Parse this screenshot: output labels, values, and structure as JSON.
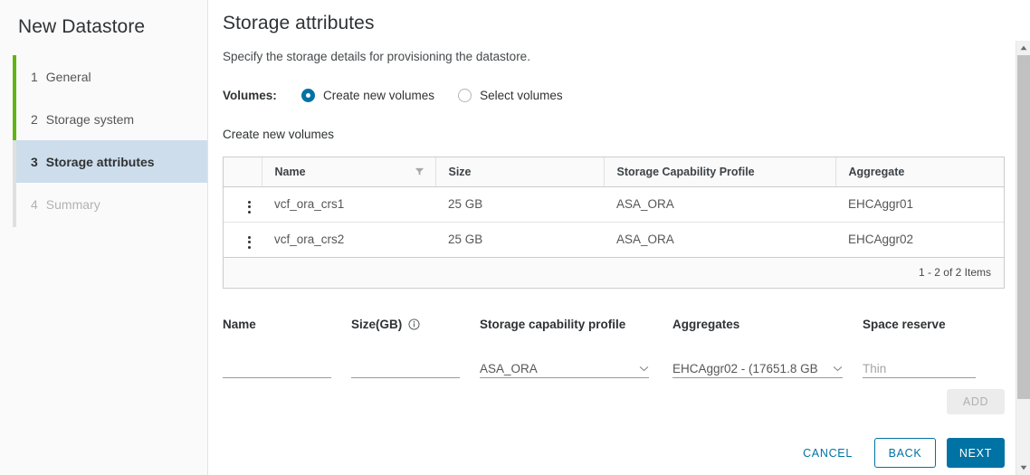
{
  "sidebar": {
    "title": "New Datastore",
    "steps": [
      {
        "num": "1",
        "label": "General",
        "state": "done"
      },
      {
        "num": "2",
        "label": "Storage system",
        "state": "done"
      },
      {
        "num": "3",
        "label": "Storage attributes",
        "state": "active"
      },
      {
        "num": "4",
        "label": "Summary",
        "state": "disabled"
      }
    ],
    "rail_color_done": "#60b515",
    "rail_color_pending": "#e0e0e0",
    "active_bg": "#cdddeb"
  },
  "page": {
    "title": "Storage attributes",
    "description": "Specify the storage details for provisioning the datastore."
  },
  "volumes": {
    "label": "Volumes:",
    "options": [
      {
        "label": "Create new volumes",
        "selected": true
      },
      {
        "label": "Select volumes",
        "selected": false
      }
    ],
    "accent": "#0072a3"
  },
  "create_section": {
    "heading": "Create new volumes"
  },
  "table": {
    "columns": [
      "Name",
      "Size",
      "Storage Capability Profile",
      "Aggregate"
    ],
    "filter_icon": "filter-funnel-icon",
    "rows": [
      {
        "menu": "row-menu-icon",
        "name": "vcf_ora_crs1",
        "size": "25 GB",
        "profile": "ASA_ORA",
        "aggregate": "EHCAggr01"
      },
      {
        "menu": "row-menu-icon",
        "name": "vcf_ora_crs2",
        "size": "25 GB",
        "profile": "ASA_ORA",
        "aggregate": "EHCAggr02"
      }
    ],
    "footer_count": "1 - 2 of 2 Items"
  },
  "form": {
    "name": {
      "label": "Name",
      "value": "",
      "placeholder": ""
    },
    "size": {
      "label": "Size(GB)",
      "value": "",
      "placeholder": "",
      "info_icon": "info-circle-icon"
    },
    "scp": {
      "label": "Storage capability profile",
      "value": "ASA_ORA",
      "chevron": "chevron-down-icon"
    },
    "aggregates": {
      "label": "Aggregates",
      "value": "EHCAggr02 - (17651.8 GB",
      "chevron": "chevron-down-icon"
    },
    "space_reserve": {
      "label": "Space reserve",
      "value": "",
      "placeholder": "Thin"
    },
    "add_label": "ADD"
  },
  "footer": {
    "cancel": "CANCEL",
    "back": "BACK",
    "next": "NEXT",
    "primary_color": "#0072a3"
  },
  "scrollbar": {
    "up_icon": "scroll-up-arrow-icon",
    "down_icon": "scroll-down-arrow-icon"
  }
}
